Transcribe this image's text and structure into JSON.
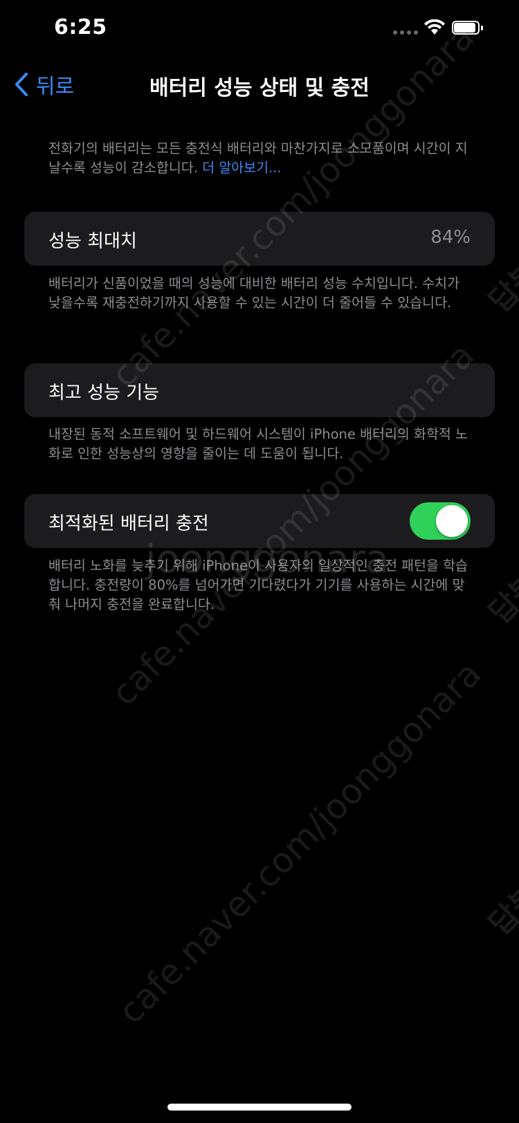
{
  "status_bar": {
    "time": "6:25",
    "battery_level": 0.9
  },
  "nav": {
    "back_label": "뒤로",
    "title": "배터리 성능 상태 및 충전"
  },
  "intro": {
    "text": "전화기의 배터리는 모든 충전식 배터리와 마찬가지로 소모품이며 시간이 지날수록 성능이 감소합니다. ",
    "link": "더 알아보기..."
  },
  "max_capacity": {
    "label": "성능 최대치",
    "value": "84%",
    "description": "배터리가 신품이었을 때의 성능에 대비한 배터리 성능 수치입니다. 수치가 낮을수록 재충전하기까지 사용할 수 있는 시간이 더 줄어들 수 있습니다."
  },
  "peak_performance": {
    "label": "최고 성능 기능",
    "description": "내장된 동적 소프트웨어 및 하드웨어 시스템이 iPhone 배터리의 화학적 노화로 인한 성능상의 영향을 줄이는 데 도움이 됩니다."
  },
  "optimized_charging": {
    "label": "최적화된 배터리 충전",
    "enabled": true,
    "description": "배터리 노화를 늦추기 위해 iPhone이 사용자의 일상적인 충전 패턴을 학습합니다. 충전량이 80%를 넘어가면 기다렸다가 기기를 사용하는 시간에 맞춰 나머지 충전을 완료합니다."
  },
  "watermark": {
    "url_text": "cafe.naver.com/joonggonara",
    "brand_text": "joonggonara",
    "side_text": "답봉"
  },
  "colors": {
    "accent": "#3a8bf7",
    "toggle_on": "#30d158",
    "cell_bg": "#1c1c1e",
    "secondary_text": "#8e8e93"
  }
}
